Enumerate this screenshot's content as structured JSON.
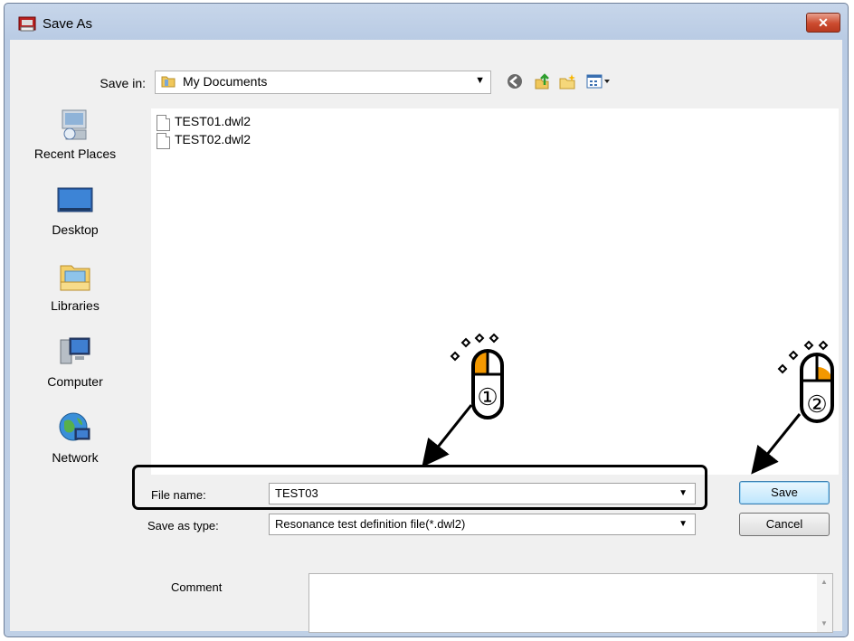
{
  "window": {
    "title": "Save As",
    "close_glyph": "✕"
  },
  "toolbar": {
    "save_in_label": "Save in:",
    "save_in_value": "My Documents",
    "icons": [
      "back-icon",
      "up-folder-icon",
      "new-folder-icon",
      "view-menu-icon"
    ]
  },
  "places": [
    {
      "label": "Recent Places",
      "icon": "recent-places-icon"
    },
    {
      "label": "Desktop",
      "icon": "desktop-icon"
    },
    {
      "label": "Libraries",
      "icon": "libraries-icon"
    },
    {
      "label": "Computer",
      "icon": "computer-icon"
    },
    {
      "label": "Network",
      "icon": "network-icon"
    }
  ],
  "files": [
    "TEST01.dwl2",
    "TEST02.dwl2"
  ],
  "form": {
    "file_name_label": "File name:",
    "file_name_value": "TEST03",
    "save_type_label": "Save as type:",
    "save_type_value": "Resonance test definition file(*.dwl2)",
    "comment_label": "Comment",
    "comment_value": ""
  },
  "buttons": {
    "save": "Save",
    "cancel": "Cancel"
  },
  "annotations": {
    "step1": "①",
    "step2": "②"
  },
  "colors": {
    "mouse_button_highlight": "#f39800",
    "title_bar": "#bfd0e6",
    "close_button": "#cc4b2f"
  }
}
